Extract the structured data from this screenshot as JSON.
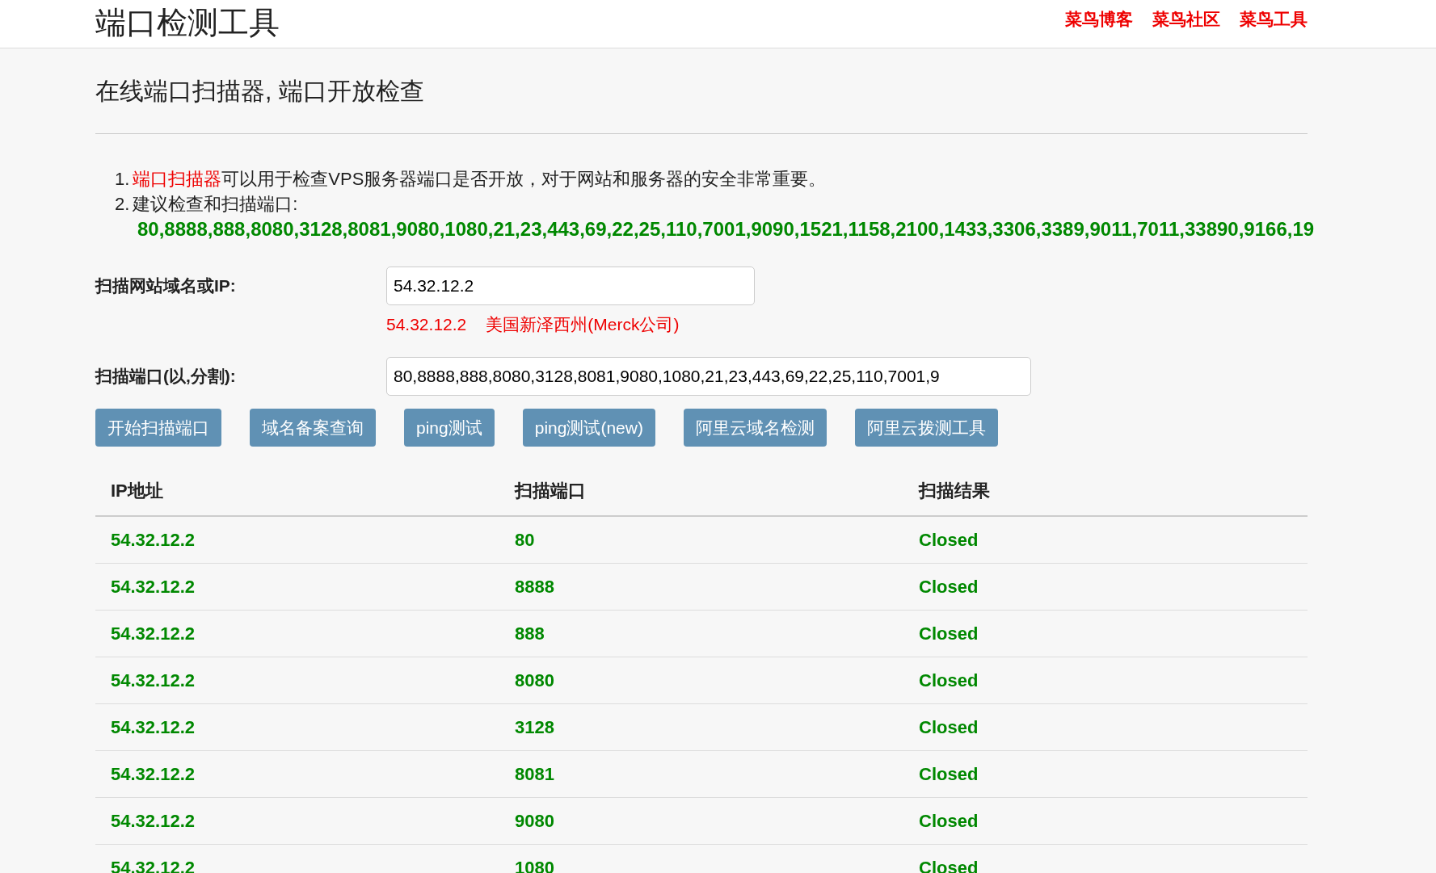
{
  "header": {
    "title": "端口检测工具",
    "links": [
      "菜鸟博客",
      "菜鸟社区",
      "菜鸟工具"
    ]
  },
  "subtitle": "在线端口扫描器, 端口开放检查",
  "notes": [
    {
      "marker": "1.",
      "text": "端口扫描器",
      "rest": "可以用于检查VPS服务器端口是否开放，对于网站和服务器的安全非常重要。"
    },
    {
      "marker": "2.",
      "text": "建议检查和扫描端口:",
      "ports": "80,8888,888,8080,3128,8081,9080,1080,21,23,443,69,22,25,110,7001,9090,1521,1158,2100,1433,3306,3389,9011,7011,33890,9166,19"
    }
  ],
  "form": {
    "host_label": "扫描网站域名或IP:",
    "host_value": "54.32.12.2",
    "location_ip": "54.32.12.2",
    "location": "美国新泽西州(Merck公司)",
    "ports_label": "扫描端口(以,分割):",
    "ports_value": "80,8888,888,8080,3128,8081,9080,1080,21,23,443,69,22,25,110,7001,9"
  },
  "buttons": [
    "开始扫描端口",
    "域名备案查询",
    "ping测试",
    "ping测试(new)",
    "阿里云域名检测",
    "阿里云拨测工具"
  ],
  "table": {
    "columns": [
      "IP地址",
      "扫描端口",
      "扫描结果"
    ],
    "rows": [
      [
        "54.32.12.2",
        "80",
        "Closed"
      ],
      [
        "54.32.12.2",
        "8888",
        "Closed"
      ],
      [
        "54.32.12.2",
        "888",
        "Closed"
      ],
      [
        "54.32.12.2",
        "8080",
        "Closed"
      ],
      [
        "54.32.12.2",
        "3128",
        "Closed"
      ],
      [
        "54.32.12.2",
        "8081",
        "Closed"
      ],
      [
        "54.32.12.2",
        "9080",
        "Closed"
      ],
      [
        "54.32.12.2",
        "1080",
        "Closed"
      ]
    ]
  }
}
